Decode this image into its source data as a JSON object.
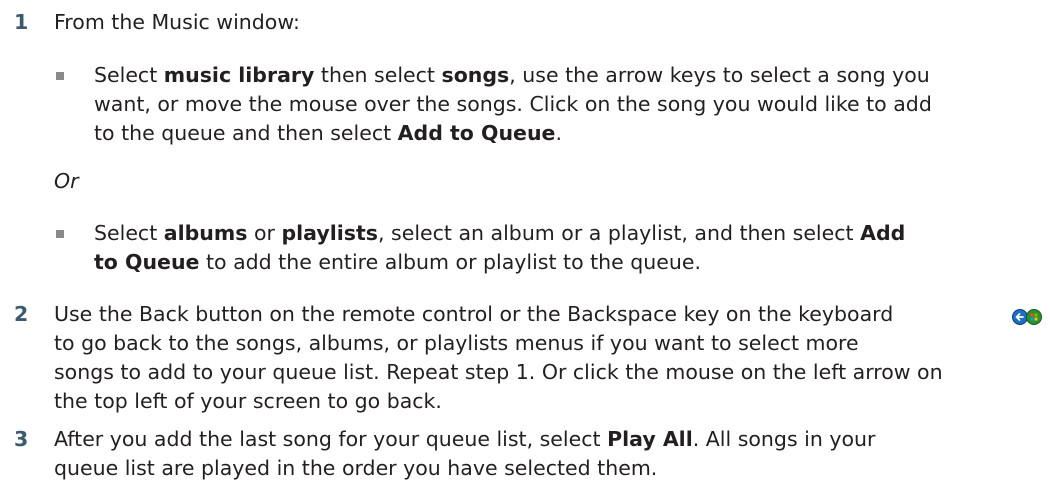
{
  "steps": [
    {
      "number": "1",
      "intro": "From the Music window:",
      "bullet1": {
        "line1": {
          "t1": "Select ",
          "b1": "music library",
          "t2": " then select ",
          "b2": "songs",
          "t3": ", use the arrow keys to select a song you"
        },
        "line2": "want, or move the mouse over the songs. Click on the song you would like to add",
        "line3": {
          "t1": "to the queue and then select ",
          "b1": "Add to Queue",
          "t2": "."
        }
      },
      "or_label": "Or",
      "bullet2": {
        "line1": {
          "t1": "Select ",
          "b1": "albums",
          "t2": " or ",
          "b2": "playlists",
          "t3": ", select an album or a playlist, and then select ",
          "b3": "Add"
        },
        "line2": {
          "b1": "to Queue",
          "t1": " to add the entire album or playlist to the queue."
        }
      }
    },
    {
      "number": "2",
      "lines": [
        "Use the Back button on the remote control or the Backspace key on the keyboard",
        "to go back to the songs, albums, or playlists menus if you want to select more",
        "songs to add to your queue list. Repeat step 1. Or click the mouse on the left arrow on",
        "the top left of your screen to go back."
      ],
      "icon": "back-button-icon"
    },
    {
      "number": "3",
      "line1": {
        "t1": "After you add the last song for your queue list, select ",
        "b1": "Play All",
        "t2": ". All songs in your"
      },
      "line2": "queue list are played in the order you have selected them."
    }
  ],
  "colors": {
    "text": "#231f20",
    "step_number": "#3b5a6e",
    "bullet": "#8a8a8a",
    "icon_blue": "#1c6fc4",
    "icon_green": "#3aa635"
  }
}
